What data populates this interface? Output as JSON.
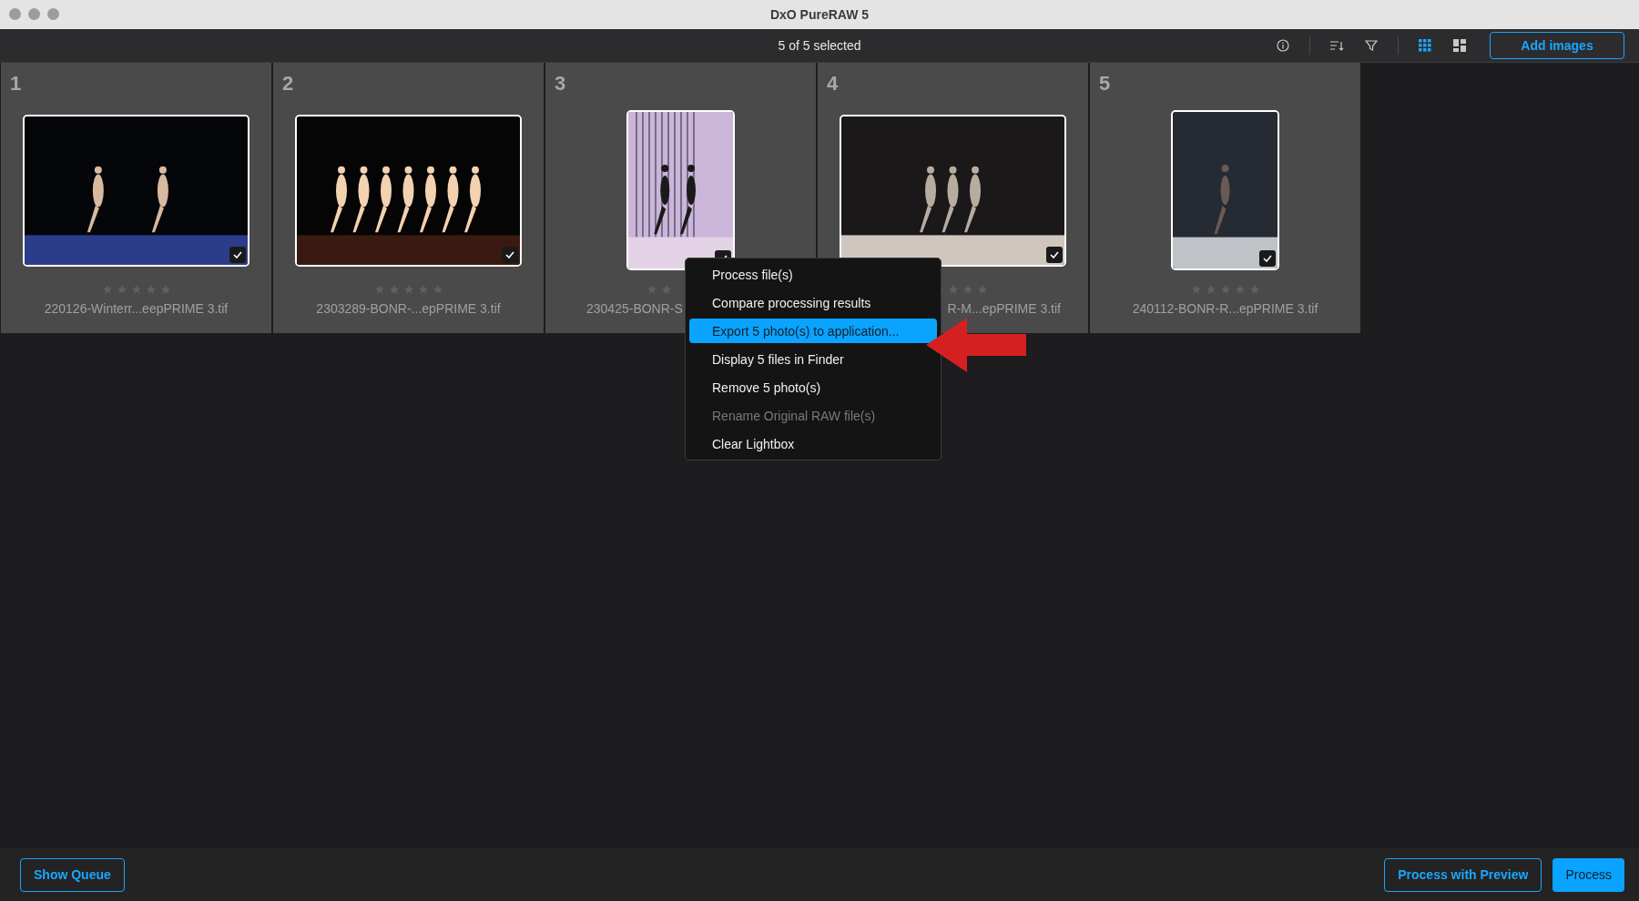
{
  "window": {
    "title": "DxO PureRAW 5"
  },
  "toolbar": {
    "selection": "5 of 5 selected",
    "views": [
      {
        "kind": "grid",
        "selected": true
      },
      {
        "kind": "mosaic",
        "selected": false
      }
    ],
    "add_button": "Add images"
  },
  "tiles": [
    {
      "number": "1",
      "filename": "220126-Winterr...eepPRIME 3.tif",
      "checked": true,
      "stars": 0,
      "kind": "landscape",
      "cut_start": false,
      "cut_end": false
    },
    {
      "number": "2",
      "filename": "2303289-BONR-...epPRIME 3.tif",
      "checked": true,
      "stars": 0,
      "kind": "landscape",
      "cut_start": false,
      "cut_end": false
    },
    {
      "number": "3",
      "filename": "230425-BONR-S",
      "checked": true,
      "kind": "portrait",
      "cut_start": false,
      "cut_end": true
    },
    {
      "number": "4",
      "filename": "R-M...epPRIME 3.tif",
      "checked": true,
      "stars": 0,
      "kind": "landscape",
      "cut_start": true,
      "cut_end": false
    },
    {
      "number": "5",
      "filename": "240112-BONR-R...epPRIME 3.tif",
      "checked": true,
      "stars": 0,
      "kind": "portrait",
      "cut_start": false,
      "cut_end": false
    }
  ],
  "context_menu": [
    {
      "label": "Process file(s)",
      "selected": false,
      "disabled": false
    },
    {
      "label": "Compare processing results",
      "selected": false,
      "disabled": false
    },
    {
      "label": "Export 5 photo(s) to application...",
      "selected": true,
      "disabled": false
    },
    {
      "label": "Display 5 files in Finder",
      "selected": false,
      "disabled": false
    },
    {
      "label": "Remove 5 photo(s)",
      "selected": false,
      "disabled": false
    },
    {
      "label": "Rename Original RAW file(s)",
      "selected": false,
      "disabled": true
    },
    {
      "label": "Clear Lightbox",
      "selected": false,
      "disabled": false
    }
  ],
  "bottom_bar": {
    "show_queue": "Show Queue",
    "process_preview": "Process with Preview",
    "process": "Process"
  }
}
